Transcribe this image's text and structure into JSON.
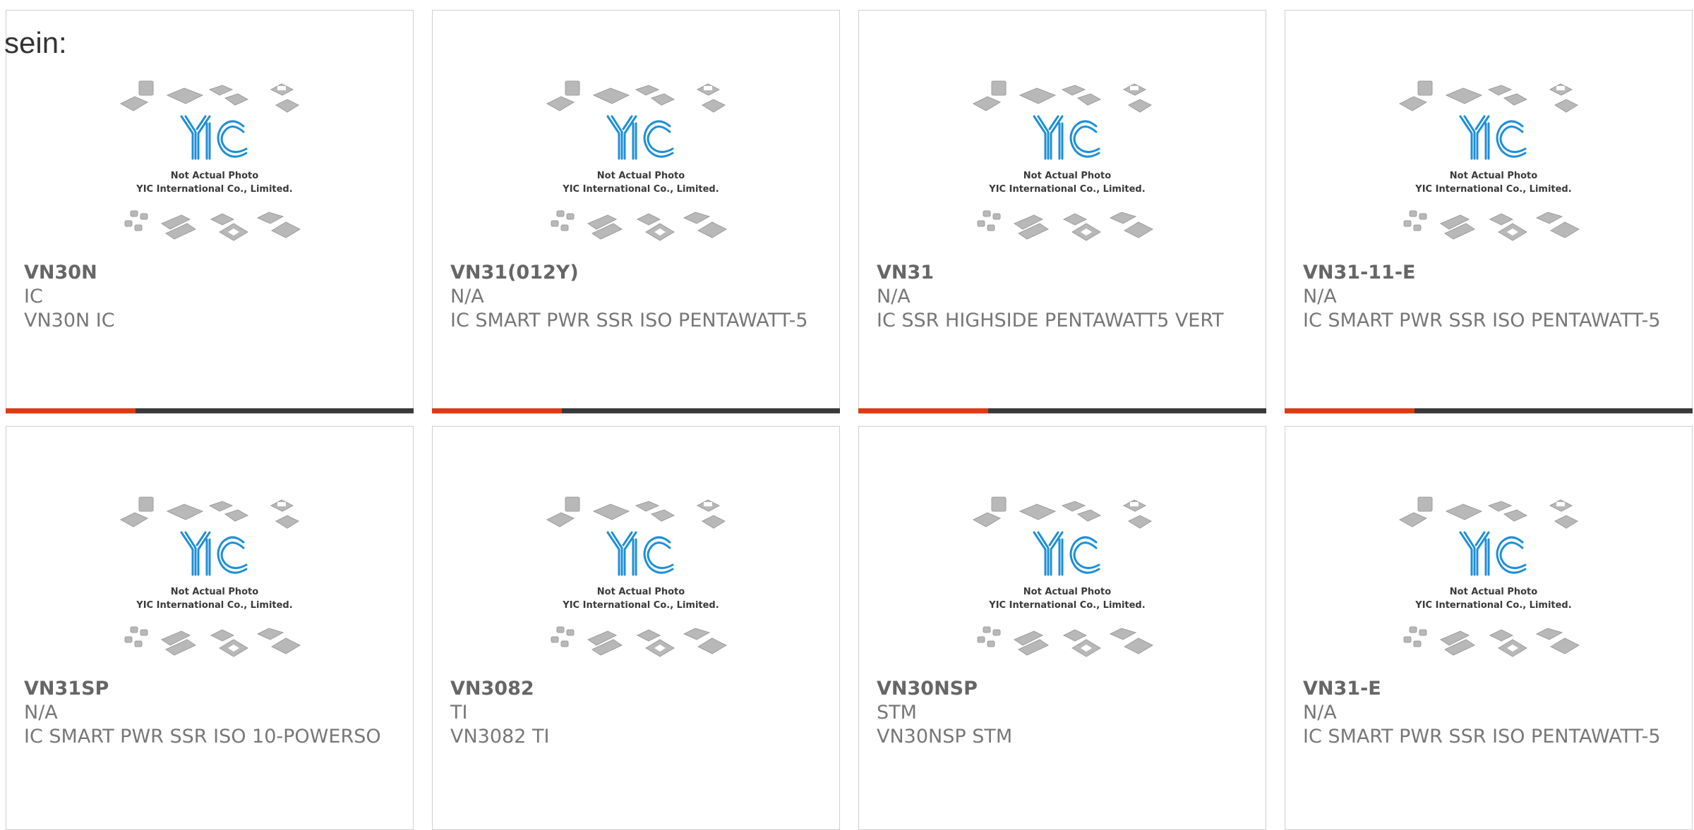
{
  "intro_text": "sein:",
  "placeholder": {
    "line1": "Not Actual Photo",
    "line2": "YIC International Co., Limited."
  },
  "colors": {
    "accent": "#dd3c12",
    "bar": "#3a3a3a",
    "logo_blue": "#1d8fd8",
    "chip_gray": "#b8b8b8"
  },
  "products": [
    {
      "title": "VN30N",
      "manufacturer": "IC",
      "description": "VN30N IC",
      "has_bar": true
    },
    {
      "title": "VN31(012Y)",
      "manufacturer": "N/A",
      "description": "IC SMART PWR SSR ISO PENTAWATT-5",
      "has_bar": true
    },
    {
      "title": "VN31",
      "manufacturer": "N/A",
      "description": "IC SSR HIGHSIDE PENTAWATT5 VERT",
      "has_bar": true
    },
    {
      "title": "VN31-11-E",
      "manufacturer": "N/A",
      "description": "IC SMART PWR SSR ISO PENTAWATT-5",
      "has_bar": true
    },
    {
      "title": "VN31SP",
      "manufacturer": "N/A",
      "description": "IC SMART PWR SSR ISO 10-POWERSO",
      "has_bar": false
    },
    {
      "title": "VN3082",
      "manufacturer": "TI",
      "description": "VN3082 TI",
      "has_bar": false
    },
    {
      "title": "VN30NSP",
      "manufacturer": "STM",
      "description": "VN30NSP STM",
      "has_bar": false
    },
    {
      "title": "VN31-E",
      "manufacturer": "N/A",
      "description": "IC SMART PWR SSR ISO PENTAWATT-5",
      "has_bar": false
    }
  ]
}
